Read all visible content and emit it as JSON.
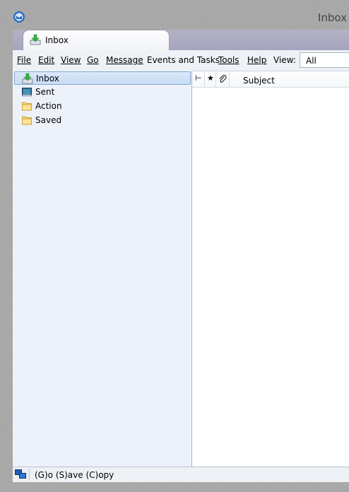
{
  "window": {
    "title": "Inbox"
  },
  "tab": {
    "label": "Inbox",
    "icon": "inbox-download-icon"
  },
  "menu": {
    "file": "File",
    "edit": "Edit",
    "view": "View",
    "go": "Go",
    "message": "Message",
    "events": "Events and Tasks",
    "tools": "Tools",
    "help": "Help",
    "view_label": "View:",
    "view_value": "All"
  },
  "folders": [
    {
      "label": "Inbox",
      "icon": "inbox-download-icon",
      "selected": true
    },
    {
      "label": "Sent",
      "icon": "sent-icon",
      "selected": false
    },
    {
      "label": "Action",
      "icon": "folder-icon",
      "selected": false
    },
    {
      "label": "Saved",
      "icon": "folder-icon",
      "selected": false
    }
  ],
  "columns": {
    "subject": "Subject",
    "star": "★",
    "thread": "⊢"
  },
  "status": {
    "text": "(G)o (S)ave (C)opy",
    "icon": "network-status-icon"
  },
  "colors": {
    "accent": "#86a6d1",
    "folder_pane_bg": "#edf2fa",
    "tabbar_bg": "#a6a4bd"
  }
}
